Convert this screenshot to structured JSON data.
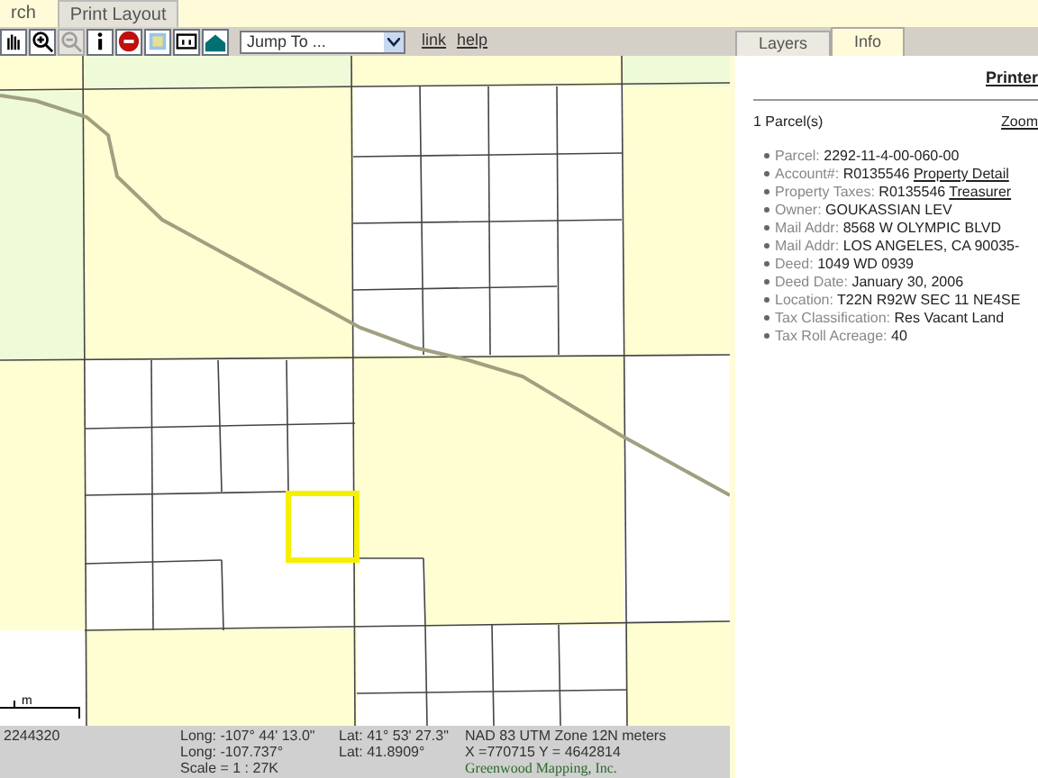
{
  "tabs": [
    {
      "label": "rch",
      "selected": true
    },
    {
      "label": "Print Layout",
      "selected": false
    }
  ],
  "toolbar": {
    "tools": [
      {
        "kind": "pan",
        "disabled": false
      },
      {
        "kind": "zoom_in",
        "disabled": false
      },
      {
        "kind": "zoom_out",
        "disabled": true
      },
      {
        "kind": "info",
        "disabled": false
      },
      {
        "kind": "stop",
        "disabled": false
      },
      {
        "kind": "layers",
        "disabled": false
      },
      {
        "kind": "screen",
        "disabled": false
      },
      {
        "kind": "home",
        "disabled": false
      }
    ],
    "jump_to": {
      "value": "Jump To ..."
    },
    "links": [
      "link",
      "help"
    ]
  },
  "map": {
    "scale_label": "m"
  },
  "panel": {
    "tabs": [
      {
        "label": "Layers",
        "selected": false
      },
      {
        "label": "Info",
        "selected": true
      }
    ],
    "heading": "Printer",
    "count": "1 Parcel(s)",
    "zoom_link": "Zoom",
    "fields": [
      {
        "label": "Parcel:",
        "value": "2292-11-4-00-060-00"
      },
      {
        "label": "Account#:",
        "value": "R0135546",
        "link": "Property Detail"
      },
      {
        "label": "Property Taxes:",
        "value": "R0135546",
        "link": "Treasurer"
      },
      {
        "label": "Owner:",
        "value": "GOUKASSIAN LEV"
      },
      {
        "label": "Mail Addr:",
        "value": "8568 W OLYMPIC BLVD"
      },
      {
        "label": "Mail Addr:",
        "value": "LOS ANGELES, CA 90035-"
      },
      {
        "label": "Deed:",
        "value": "1049 WD 0939"
      },
      {
        "label": "Deed Date:",
        "value": "January 30, 2006"
      },
      {
        "label": "Location:",
        "value": "T22N R92W SEC 11 NE4SE"
      },
      {
        "label": "Tax Classification:",
        "value": "Res Vacant Land"
      },
      {
        "label": "Tax Roll Acreage:",
        "value": "40"
      }
    ]
  },
  "status": {
    "code": "2244320",
    "rows": [
      [
        "Long: -107° 44' 13.0\"",
        "Lat: 41° 53' 27.3\"",
        "NAD 83 UTM Zone 12N meters"
      ],
      [
        "Long: -107.737°",
        "Lat: 41.8909°",
        "X =770715 Y = 4642814"
      ],
      [
        "Scale = 1 : 27K"
      ]
    ],
    "credit": "Greenwood Mapping, Inc."
  }
}
